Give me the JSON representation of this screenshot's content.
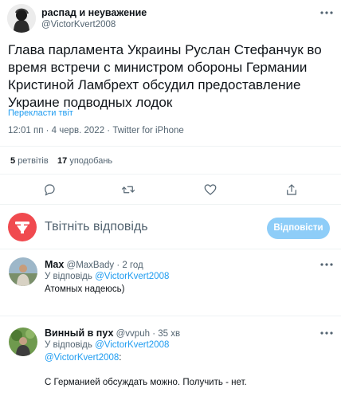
{
  "main_tweet": {
    "author_name": "распад и неуважение",
    "author_handle": "@VictorKvert2008",
    "text": "Глава парламента Украины Руслан Стефанчук во время встречи с министром обороны Германии Кристиной Ламбрехт обсудил предоставление Украине подводных лодок",
    "translate_label": "Перекласти твіт",
    "meta": "12:01 пп · 4 черв. 2022 · Twitter for iPhone",
    "retweets_count": "5",
    "retweets_label": "ретвітів",
    "likes_count": "17",
    "likes_label": "уподобань"
  },
  "composer": {
    "placeholder": "Твітніть відповідь",
    "reply_button": "Відповісти"
  },
  "replies": [
    {
      "author_name": "Max",
      "author_handle": "@MaxBady",
      "time": "· 2 год",
      "replying_prefix": "У відповідь",
      "replying_to": "@VictorKvert2008",
      "text": "Атомных надеюсь)"
    },
    {
      "author_name": "Винный в пух",
      "author_handle": "@vvpuh",
      "time": "· 35 хв",
      "replying_prefix": "У відповідь",
      "replying_to": "@VictorKvert2008",
      "mention": "@VictorKvert2008",
      "mention_suffix": ":",
      "text": "С Германией обсуждать можно. Получить - нет."
    }
  ]
}
